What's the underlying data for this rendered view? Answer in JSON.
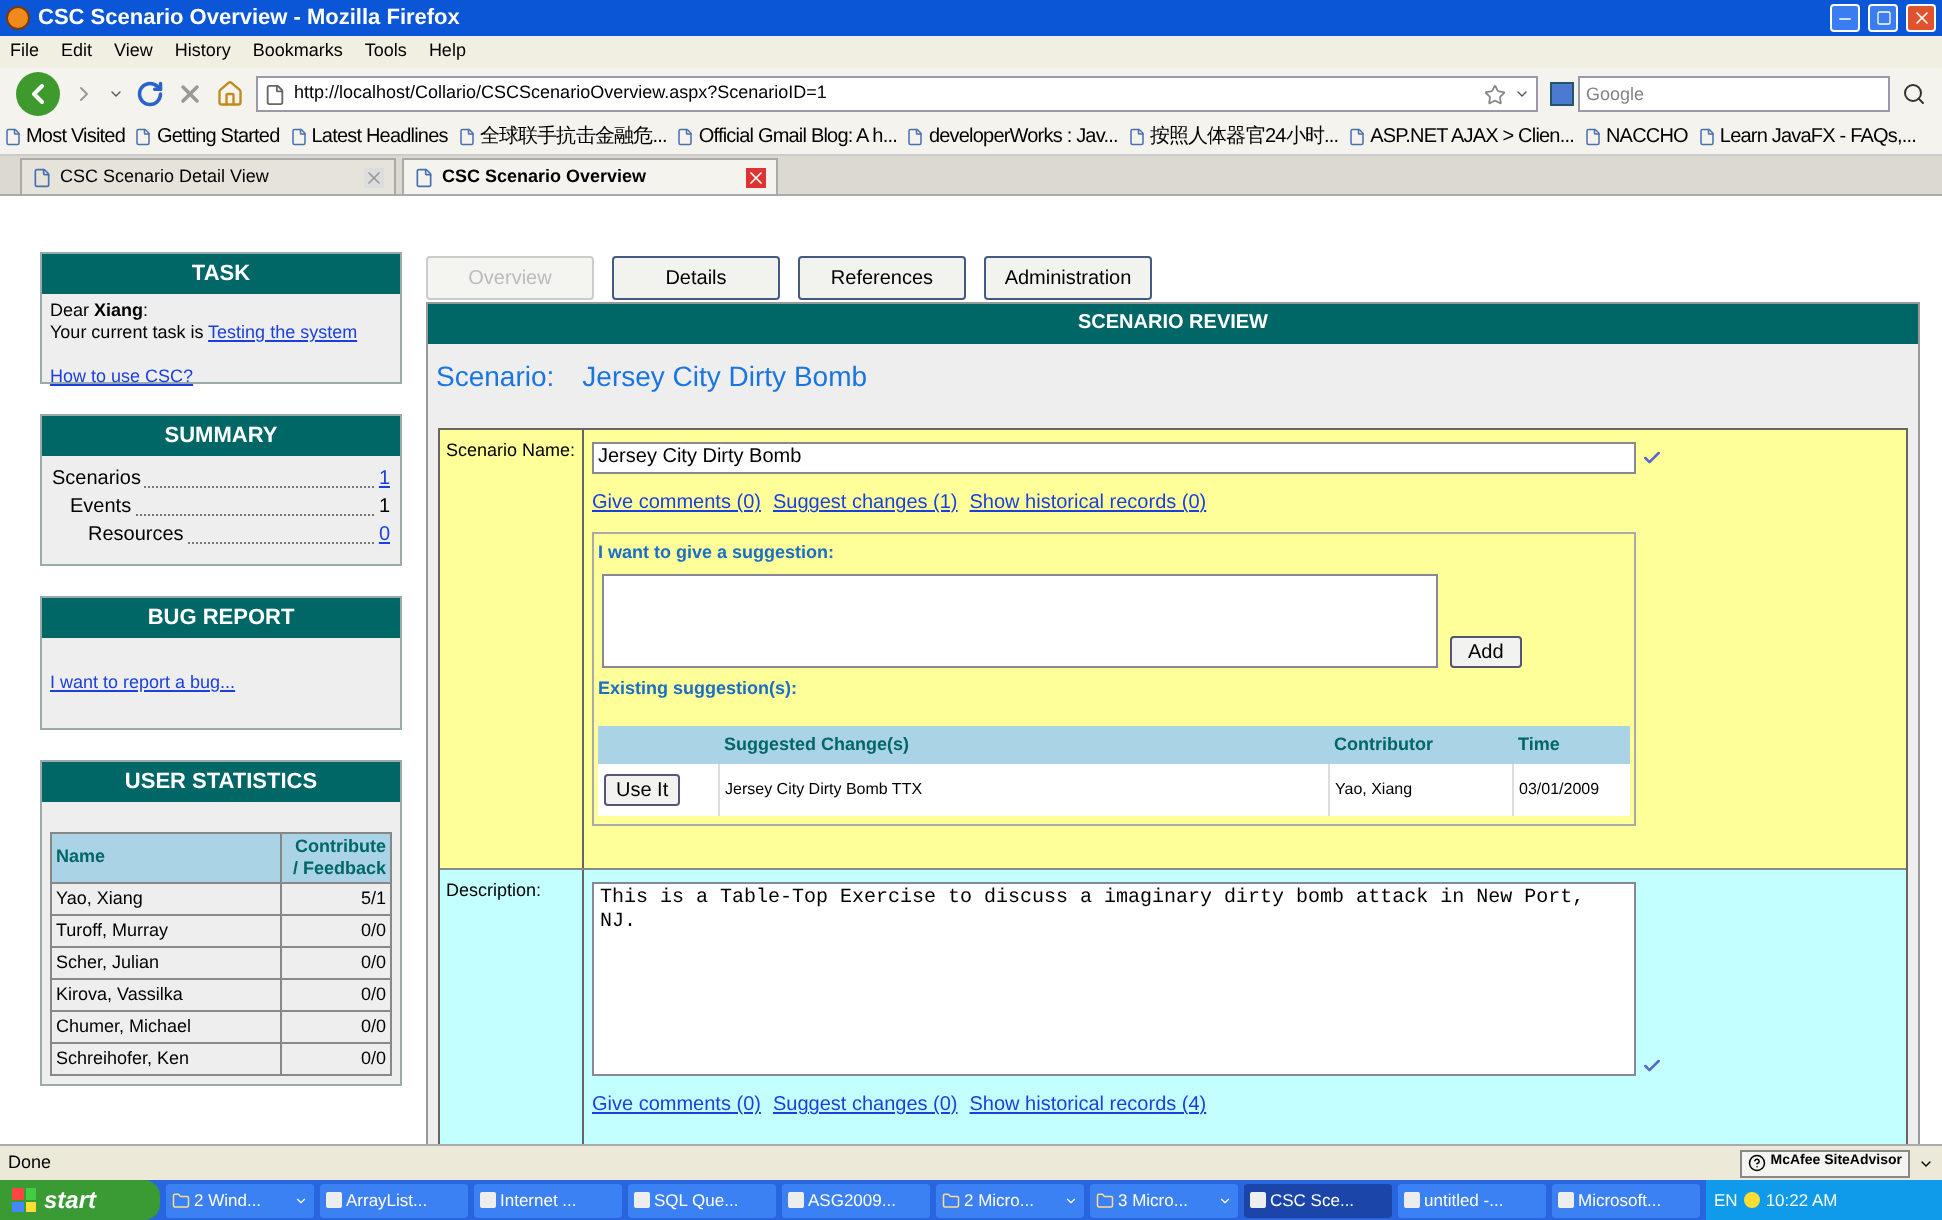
{
  "window": {
    "title": "CSC Scenario Overview - Mozilla Firefox"
  },
  "menu": [
    "File",
    "Edit",
    "View",
    "History",
    "Bookmarks",
    "Tools",
    "Help"
  ],
  "address": {
    "url": "http://localhost/Collario/CSCScenarioOverview.aspx?ScenarioID=1"
  },
  "search": {
    "placeholder": "Google"
  },
  "bookmarks": [
    {
      "label": "Most Visited"
    },
    {
      "label": "Getting Started"
    },
    {
      "label": "Latest Headlines"
    },
    {
      "label": "全球联手抗击金融危..."
    },
    {
      "label": "Official Gmail Blog: A h..."
    },
    {
      "label": "developerWorks : Jav..."
    },
    {
      "label": "按照人体器官24小时..."
    },
    {
      "label": "ASP.NET AJAX > Clien..."
    },
    {
      "label": "NACCHO"
    },
    {
      "label": "Learn JavaFX - FAQs,..."
    }
  ],
  "browser_tabs": [
    {
      "label": "CSC Scenario Detail View",
      "selected": false
    },
    {
      "label": "CSC Scenario Overview",
      "selected": true
    }
  ],
  "sidebar": {
    "task": {
      "title": "TASK",
      "greeting": "Dear **Xiang**:",
      "task_text": "Your current task is",
      "task_link": "Testing the system",
      "help_link": "How to use CSC?"
    },
    "summary": {
      "title": "SUMMARY",
      "items": [
        {
          "label": "Scenarios",
          "value": "1",
          "linked": true,
          "children": [
            {
              "label": "Events",
              "value": "1",
              "linked": false,
              "children": [
                {
                  "label": "Resources",
                  "value": "0",
                  "linked": true
                }
              ]
            }
          ]
        }
      ]
    },
    "bug_report": {
      "title": "BUG REPORT",
      "link": "I want to report a bug..."
    },
    "user_statistics": {
      "title": "USER STATISTICS",
      "columns": [
        "Name",
        "Contribute / Feedback"
      ],
      "rows": [
        [
          "Yao, Xiang",
          "5/1"
        ],
        [
          "Turoff, Murray",
          "0/0"
        ],
        [
          "Scher, Julian",
          "0/0"
        ],
        [
          "Kirova, Vassilka",
          "0/0"
        ],
        [
          "Chumer, Michael",
          "0/0"
        ],
        [
          "Schreihofer, Ken",
          "0/0"
        ]
      ]
    }
  },
  "page_tabs": [
    {
      "label": "Overview",
      "selected": true
    },
    {
      "label": "Details",
      "selected": false
    },
    {
      "label": "References",
      "selected": false
    },
    {
      "label": "Administration",
      "selected": false
    }
  ],
  "section_header": "SCENARIO REVIEW",
  "scenario": {
    "label": "Scenario:",
    "name": "Jersey City Dirty Bomb"
  },
  "fields": [
    {
      "kind": "input",
      "label": "Scenario Name:",
      "value": "Jersey City Dirty Bomb",
      "links": [
        "Give comments (0)",
        "Suggest changes (1)",
        "Show historical records (0)"
      ],
      "suggestion": {
        "title": "I want to give a suggestion:",
        "add_button": "Add",
        "existing_label": "Existing suggestion(s):",
        "columns": [
          "Suggested Change(s)",
          "Contributor",
          "Time"
        ],
        "rows": [
          {
            "action": "Use It",
            "change": "Jersey City Dirty Bomb TTX",
            "contributor": "Yao, Xiang",
            "time": "03/01/2009"
          }
        ]
      }
    },
    {
      "kind": "textarea",
      "label": "Description:",
      "value": "This is a Table-Top Exercise to discuss a imaginary dirty bomb attack in New Port, NJ.",
      "links": [
        "Give comments (0)",
        "Suggest changes (0)",
        "Show historical records (4)"
      ]
    }
  ],
  "status_bar": {
    "text": "Done",
    "addon": "McAfee SiteAdvisor"
  },
  "taskbar": {
    "start": "start",
    "items": [
      {
        "label": "2 Wind...",
        "grouped": true,
        "selected": false
      },
      {
        "label": "ArrayList...",
        "grouped": false,
        "selected": false
      },
      {
        "label": "Internet ...",
        "grouped": false,
        "selected": false
      },
      {
        "label": "SQL Que...",
        "grouped": false,
        "selected": false
      },
      {
        "label": "ASG2009...",
        "grouped": false,
        "selected": false
      },
      {
        "label": "2 Micro...",
        "grouped": true,
        "selected": false
      },
      {
        "label": "3 Micro...",
        "grouped": true,
        "selected": false
      },
      {
        "label": "CSC Sce...",
        "grouped": false,
        "selected": true
      },
      {
        "label": "untitled -...",
        "grouped": false,
        "selected": false
      },
      {
        "label": "Microsoft...",
        "grouped": false,
        "selected": false
      }
    ],
    "language": "EN",
    "time": "10:22 AM"
  }
}
